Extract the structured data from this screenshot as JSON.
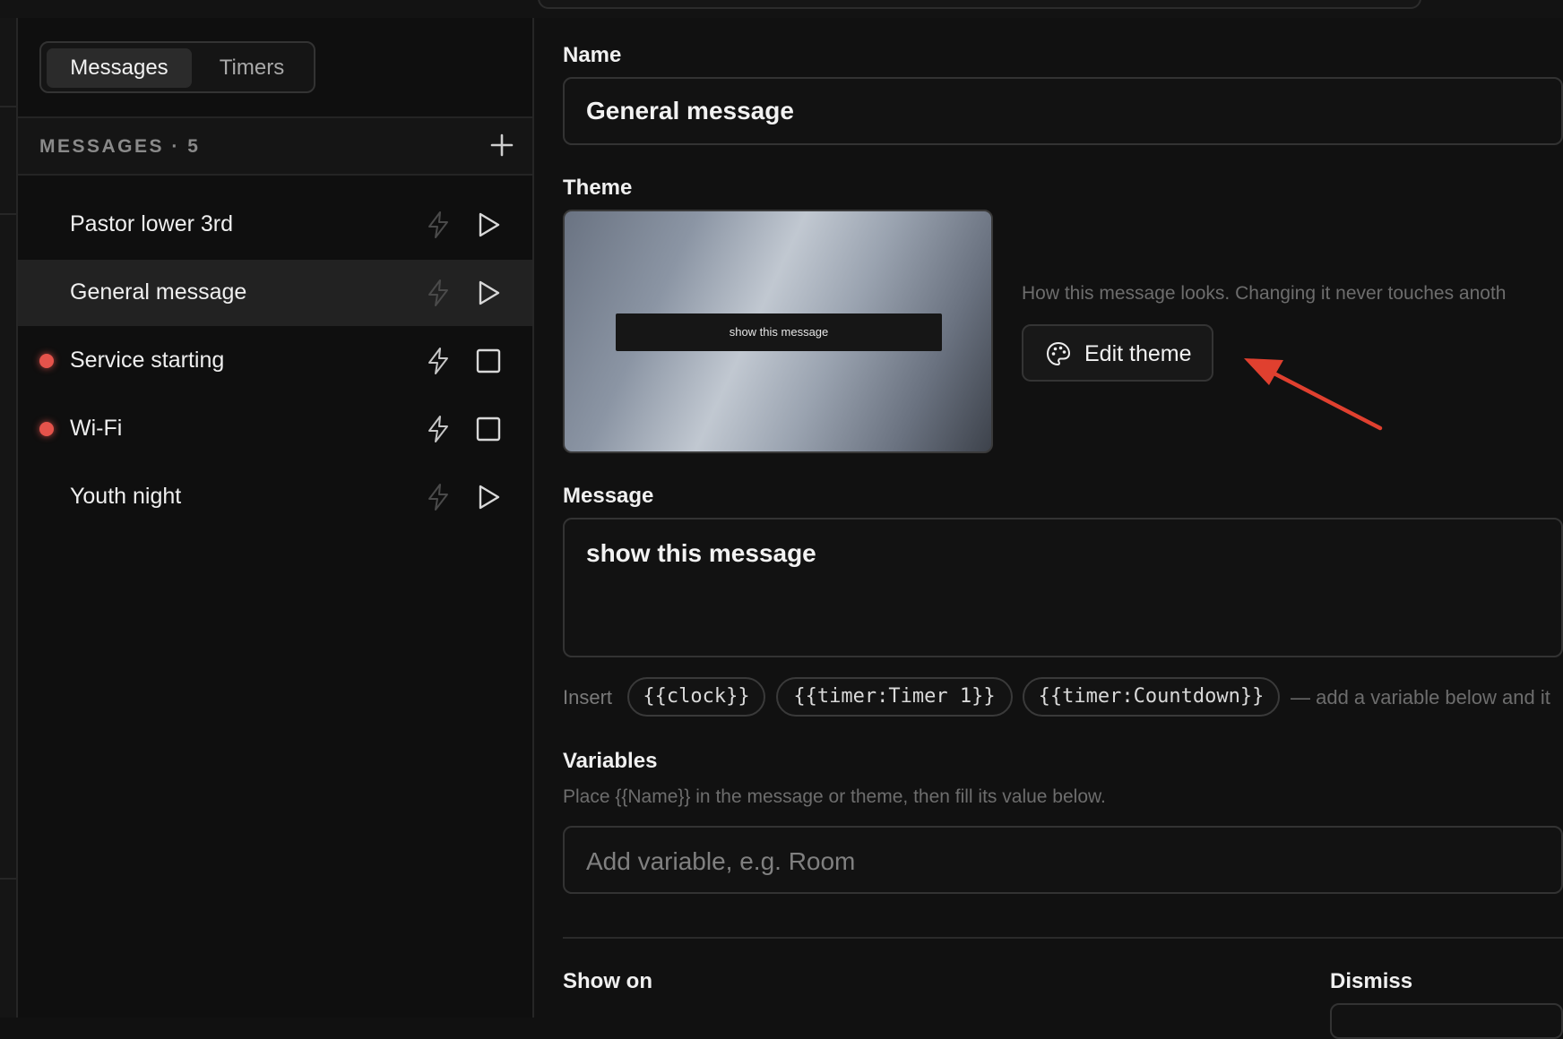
{
  "tabs": [
    {
      "label": "Messages",
      "active": true
    },
    {
      "label": "Timers",
      "active": false
    }
  ],
  "sidebar": {
    "header": "MESSAGES · 5",
    "add_icon": "plus-icon",
    "items": [
      {
        "label": "Pastor lower 3rd",
        "live": false,
        "selected": false,
        "action_icon": "play-icon"
      },
      {
        "label": "General message",
        "live": false,
        "selected": true,
        "action_icon": "play-icon"
      },
      {
        "label": "Service starting",
        "live": true,
        "selected": false,
        "action_icon": "stop-icon"
      },
      {
        "label": "Wi-Fi",
        "live": true,
        "selected": false,
        "action_icon": "stop-icon"
      },
      {
        "label": "Youth night",
        "live": false,
        "selected": false,
        "action_icon": "play-icon"
      }
    ]
  },
  "editor": {
    "name_label": "Name",
    "name_value": "General message",
    "theme_label": "Theme",
    "theme_preview_text": "show this message",
    "theme_description": "How this message looks. Changing it never touches anoth",
    "edit_theme_label": "Edit theme",
    "message_label": "Message",
    "message_value": "show this message",
    "insert_label": "Insert",
    "insert_chips": [
      "{{clock}}",
      "{{timer:Timer 1}}",
      "{{timer:Countdown}}"
    ],
    "insert_hint": "— add a variable below and it",
    "variables_label": "Variables",
    "variables_description": "Place {{Name}} in the message or theme, then fill its value below.",
    "variable_placeholder": "Add variable, e.g. Room",
    "show_on_label": "Show on",
    "dismiss_label": "Dismiss"
  },
  "colors": {
    "live_dot": "#e5534b",
    "annotation_arrow": "#e0402f",
    "background": "#111111"
  }
}
